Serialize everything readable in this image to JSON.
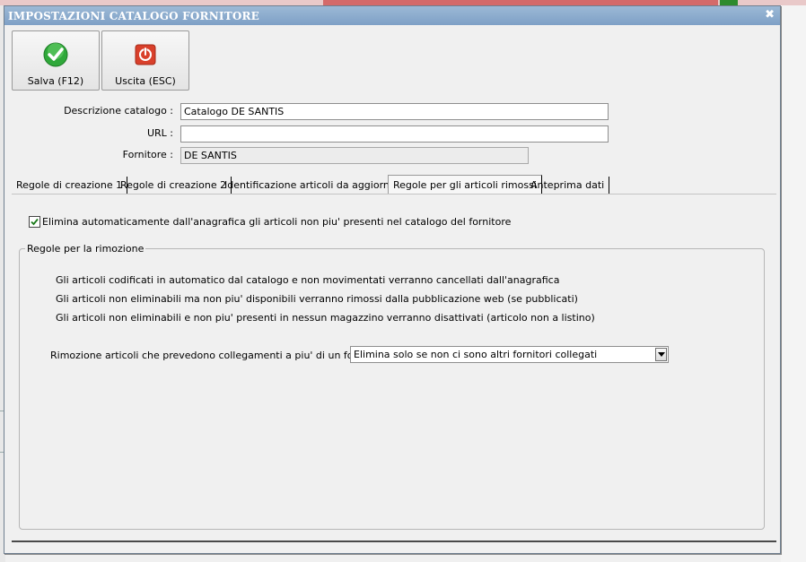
{
  "window": {
    "title": "IMPOSTAZIONI CATALOGO FORNITORE",
    "close_glyph": "✖"
  },
  "toolbar": {
    "save_label": "Salva (F12)",
    "save_icon": "check-circle-icon",
    "exit_label": "Uscita (ESC)",
    "exit_icon": "power-icon"
  },
  "form": {
    "descrizione_label": "Descrizione catalogo :",
    "descrizione_value": "Catalogo DE SANTIS",
    "url_label": "URL :",
    "url_value": "",
    "fornitore_label": "Fornitore :",
    "fornitore_value": "DE SANTIS"
  },
  "tabs": [
    {
      "label": "Regole di creazione 1"
    },
    {
      "label": "Regole di creazione 2"
    },
    {
      "label": "Identificazione articoli da aggiornare"
    },
    {
      "label": "Regole per gli articoli rimossi"
    },
    {
      "label": "Anteprima dati"
    }
  ],
  "active_tab": 3,
  "panel": {
    "auto_remove_checked": true,
    "auto_remove_label": "Elimina automaticamente dall'anagrafica gli articoli non piu' presenti nel catalogo del fornitore",
    "group_title": "Regole per la rimozione",
    "rules": [
      "Gli articoli codificati in automatico dal catalogo e non movimentati verranno cancellati dall'anagrafica",
      "Gli articoli non eliminabili ma non piu' disponibili verranno rimossi dalla pubblicazione web (se pubblicati)",
      "Gli articoli non eliminabili e non piu' presenti in nessun magazzino verranno disattivati (articolo non a listino)"
    ],
    "multi_supplier_label": "Rimozione articoli che prevedono collegamenti a piu' di un fornitore :",
    "multi_supplier_value": "Elimina solo se non ci sono altri fornitori collegati"
  },
  "colors": {
    "title_bar": "#7ea0c6",
    "save_green": "#2fa83a",
    "exit_red": "#d9402b"
  }
}
